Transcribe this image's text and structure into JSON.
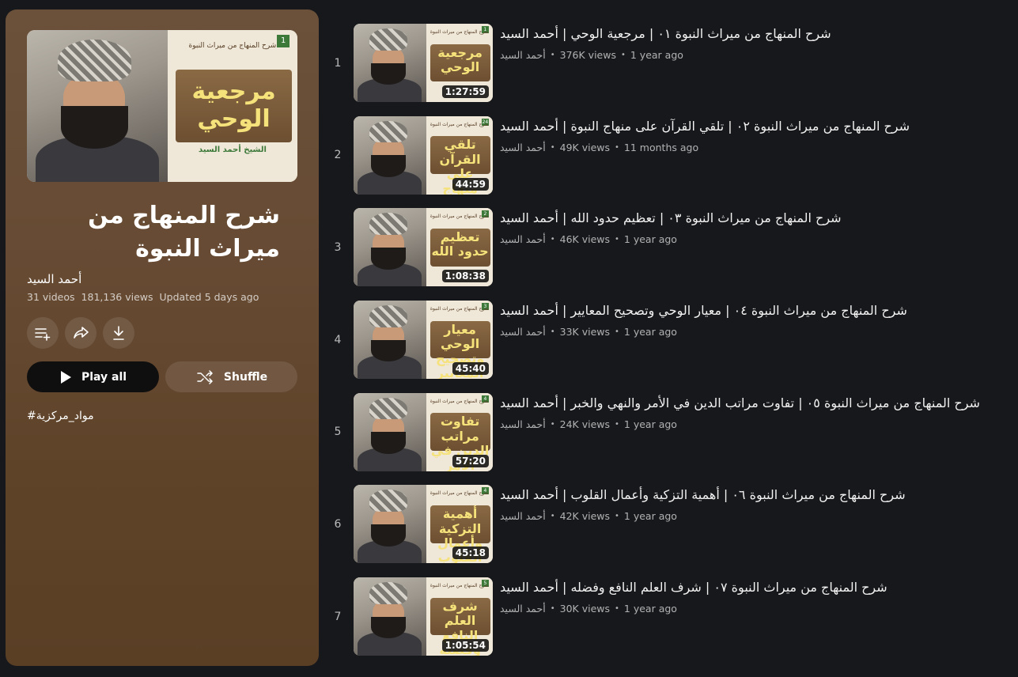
{
  "playlist": {
    "title": "شرح المنهاج من ميراث النبوة",
    "channel": "أحمد السيد",
    "video_count": "31 videos",
    "views": "181,136 views",
    "updated": "Updated 5 days ago",
    "hashtag": "#مواد_مركزية",
    "play_all_label": "Play all",
    "shuffle_label": "Shuffle",
    "thumb": {
      "panel_title": "شرح المنهاج من ميراث النبوة",
      "big_text": "مرجعية الوحي",
      "sheikh": "الشيخ أحمد السيد",
      "number": "1"
    },
    "icons": [
      "add-to-queue-icon",
      "share-icon",
      "download-icon"
    ]
  },
  "videos": [
    {
      "index": "1",
      "title": "شرح المنهاج من ميراث النبوة ٠١ | مرجعية الوحي | أحمد السيد",
      "channel": "أحمد السيد",
      "views": "376K views",
      "age": "1 year ago",
      "duration": "1:27:59",
      "thumb_text": "مرجعية الوحي",
      "thumb_num": "1"
    },
    {
      "index": "2",
      "title": "شرح المنهاج من ميراث النبوة ٠٢ | تلقي القرآن على منهاج النبوة | أحمد السيد",
      "channel": "أحمد السيد",
      "views": "49K views",
      "age": "11 months ago",
      "duration": "44:59",
      "thumb_text": "تلقي القرآن على منهاج النبوة",
      "thumb_num": "24"
    },
    {
      "index": "3",
      "title": "شرح المنهاج من ميراث النبوة ٠٣ | تعظيم حدود الله | أحمد السيد",
      "channel": "أحمد السيد",
      "views": "46K views",
      "age": "1 year ago",
      "duration": "1:08:38",
      "thumb_text": "تعظيم حدود الله",
      "thumb_num": "2"
    },
    {
      "index": "4",
      "title": "شرح المنهاج من ميراث النبوة ٠٤ | معيار الوحي وتصحيح المعايير | أحمد السيد",
      "channel": "أحمد السيد",
      "views": "33K views",
      "age": "1 year ago",
      "duration": "45:40",
      "thumb_text": "معيار الوحي وتصحيح المعايير",
      "thumb_num": "3"
    },
    {
      "index": "5",
      "title": "شرح المنهاج من ميراث النبوة ٠٥ | تفاوت مراتب الدين في الأمر والنهي والخبر | أحمد السيد",
      "channel": "أحمد السيد",
      "views": "24K views",
      "age": "1 year ago",
      "duration": "57:20",
      "thumb_text": "تفاوت مراتب الدين في الأمر والنهي والخبر",
      "thumb_num": "4"
    },
    {
      "index": "6",
      "title": "شرح المنهاج من ميراث النبوة ٠٦ | أهمية التزكية وأعمال القلوب | أحمد السيد",
      "channel": "أحمد السيد",
      "views": "42K views",
      "age": "1 year ago",
      "duration": "45:18",
      "thumb_text": "أهمية التزكية وأعمال القلوب",
      "thumb_num": "4"
    },
    {
      "index": "7",
      "title": "شرح المنهاج من ميراث النبوة ٠٧ | شرف العلم النافع وفضله | أحمد السيد",
      "channel": "أحمد السيد",
      "views": "30K views",
      "age": "1 year ago",
      "duration": "1:05:54",
      "thumb_text": "شرف العلم النافع وفضله",
      "thumb_num": "5"
    }
  ]
}
